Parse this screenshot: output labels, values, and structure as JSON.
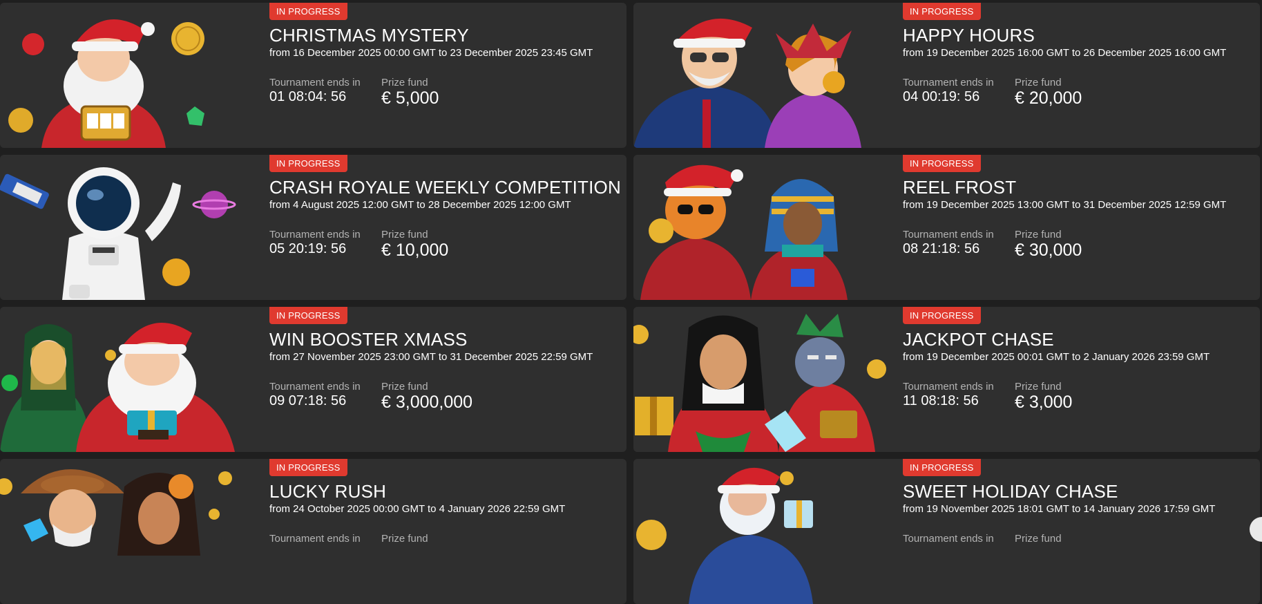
{
  "tournaments": [
    {
      "badge": "IN PROGRESS",
      "title": "CHRISTMAS MYSTERY",
      "dates": "from 16 December 2025 00:00 GMT to 23 December 2025 23:45 GMT",
      "ends_label": "Tournament ends in",
      "ends_value": "01 08:04: 56",
      "prize_label": "Prize fund",
      "prize_value": "€ 5,000",
      "image": "santa-slot-machine-illustration"
    },
    {
      "badge": "IN PROGRESS",
      "title": "HAPPY HOURS",
      "dates": "from 19 December 2025 16:00 GMT to 26 December 2025 16:00 GMT",
      "ends_label": "Tournament ends in",
      "ends_value": "04 00:19: 56",
      "prize_label": "Prize fund",
      "prize_value": "€ 20,000",
      "image": "gentleman-and-jester-illustration"
    },
    {
      "badge": "IN PROGRESS",
      "title": "CRASH ROYALE WEEKLY COMPETITION",
      "dates": "from 4 August 2025 12:00 GMT to 28 December 2025 12:00 GMT",
      "ends_label": "Tournament ends in",
      "ends_value": "05 20:19: 56",
      "prize_label": "Prize fund",
      "prize_value": "€ 10,000",
      "image": "astronaut-illustration"
    },
    {
      "badge": "IN PROGRESS",
      "title": "REEL FROST",
      "dates": "from 19 December 2025 13:00 GMT to 31 December 2025 12:59 GMT",
      "ends_label": "Tournament ends in",
      "ends_value": "08 21:18: 56",
      "prize_label": "Prize fund",
      "prize_value": "€ 30,000",
      "image": "dragon-and-pharaoh-illustration"
    },
    {
      "badge": "IN PROGRESS",
      "title": "WIN BOOSTER XMASS",
      "dates": "from 27 November 2025 23:00 GMT to 31 December 2025 22:59 GMT",
      "ends_label": "Tournament ends in",
      "ends_value": "09 07:18: 56",
      "prize_label": "Prize fund",
      "prize_value": "€ 3,000,000",
      "image": "elf-and-santa-illustration"
    },
    {
      "badge": "IN PROGRESS",
      "title": "JACKPOT CHASE",
      "dates": "from 19 December 2025 00:01 GMT to 2 January 2026 23:59 GMT",
      "ends_label": "Tournament ends in",
      "ends_value": "11 08:18: 56",
      "prize_label": "Prize fund",
      "prize_value": "€ 3,000",
      "image": "woman-and-wolf-illustration"
    },
    {
      "badge": "IN PROGRESS",
      "title": "LUCKY RUSH",
      "dates": "from 24 October 2025 00:00 GMT to 4 January 2026 22:59 GMT",
      "ends_label": "Tournament ends in",
      "ends_value": "",
      "prize_label": "Prize fund",
      "prize_value": "",
      "image": "cowboy-and-lady-illustration"
    },
    {
      "badge": "IN PROGRESS",
      "title": "SWEET HOLIDAY CHASE",
      "dates": "from 19 November 2025 18:01 GMT to 14 January 2026 17:59 GMT",
      "ends_label": "Tournament ends in",
      "ends_value": "",
      "prize_label": "Prize fund",
      "prize_value": "",
      "image": "santa-with-gift-illustration"
    }
  ],
  "colors": {
    "page_bg": "#1f1f1f",
    "card_bg": "#2f2f2f",
    "badge_bg": "#e03a2f",
    "muted_text": "#b3b3b3"
  }
}
